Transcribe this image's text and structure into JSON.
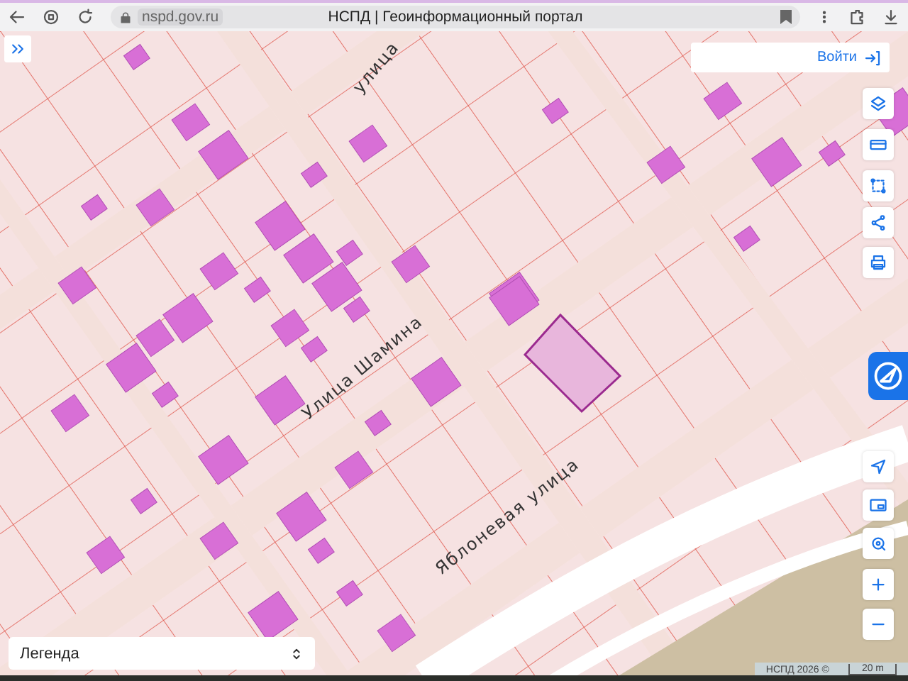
{
  "browser": {
    "url": "nspd.gov.ru",
    "title": "НСПД | Геоинформационный портал"
  },
  "map": {
    "streets": [
      {
        "name": "улица"
      },
      {
        "name": "Улица Шамина"
      },
      {
        "name": "Яблоневая улица"
      }
    ],
    "attribution": "НСПД 2026 ©",
    "scale": "20 m"
  },
  "login_button": "Войти",
  "legend": {
    "label": "Легенда"
  }
}
